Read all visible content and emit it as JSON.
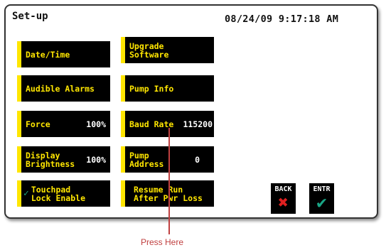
{
  "screen": {
    "title": "Set-up",
    "datetime": "08/24/09 9:17:18 AM"
  },
  "buttons": {
    "date_time": {
      "label": "Date/Time"
    },
    "upgrade_software": {
      "line1": "Upgrade",
      "line2": "Software"
    },
    "audible_alarms": {
      "label": "Audible Alarms"
    },
    "pump_info": {
      "label": "Pump Info"
    },
    "force": {
      "label": "Force",
      "value": "100%"
    },
    "baud_rate": {
      "label": "Baud Rate",
      "value": "115200"
    },
    "display_brightness": {
      "line1": "Display",
      "line2": "Brightness",
      "value": "100%"
    },
    "pump_address": {
      "line1": "Pump",
      "line2": "Address",
      "value": "0"
    },
    "touchpad_lock": {
      "line1": "Touchpad",
      "line2": "Lock Enable",
      "checked_icon": "checkmark-icon"
    },
    "resume_run": {
      "line1": "Resume Run",
      "line2": "After Pwr Loss"
    }
  },
  "nav": {
    "back": {
      "label": "BACK",
      "icon": "x-icon",
      "color": "#e02020"
    },
    "entr": {
      "label": "ENTR",
      "icon": "checkmark-icon",
      "color": "#19a585"
    }
  },
  "annotation": {
    "text": "Press Here",
    "color": "#c04040"
  },
  "colors": {
    "button_bg": "#000000",
    "button_text": "#ffe600",
    "value_text": "#ffffff"
  }
}
